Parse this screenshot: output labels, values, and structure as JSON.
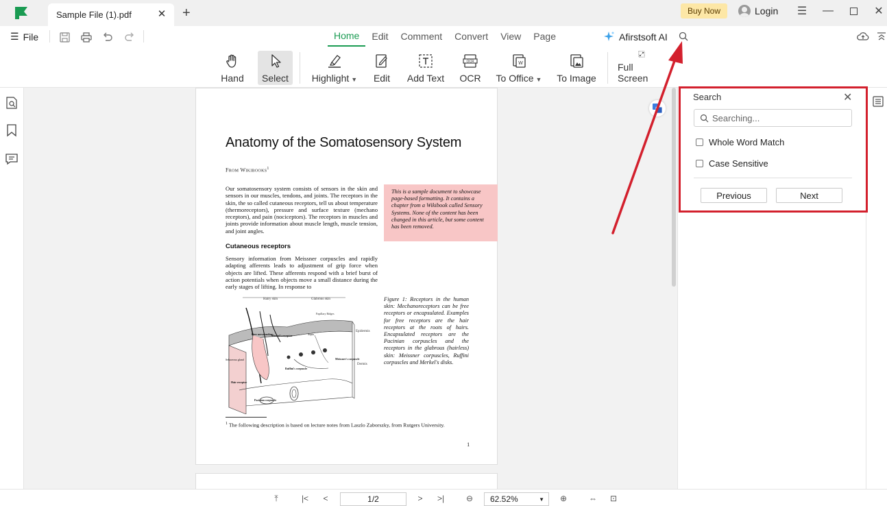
{
  "titlebar": {
    "tab_title": "Sample File (1).pdf",
    "buy_now": "Buy Now",
    "login": "Login"
  },
  "menubar": {
    "file": "File",
    "tabs": [
      "Home",
      "Edit",
      "Comment",
      "Convert",
      "View",
      "Page"
    ],
    "active_tab": "Home",
    "ai_label": "Afirstsoft AI"
  },
  "toolbar": {
    "hand": "Hand",
    "select": "Select",
    "highlight": "Highlight",
    "edit": "Edit",
    "add_text": "Add Text",
    "ocr": "OCR",
    "to_office": "To Office",
    "to_image": "To Image",
    "full_screen": "Full Screen"
  },
  "document": {
    "title": "Anatomy of the Somatosensory System",
    "byline": "From Wikibooks",
    "byline_sup": "1",
    "paragraph1": "Our somatosensory system consists of sensors in the skin and sensors in our muscles, tendons, and joints. The receptors in the skin, the so called cutaneous receptors, tell us about temperature (thermoreceptors), pressure and surface texture (mechano receptors), and pain (nociceptors). The receptors in muscles and joints provide information about muscle length, muscle tension, and joint angles.",
    "note": "This is a sample document to showcase page-based formatting. It contains a chapter from a Wikibook called Sensory Systems. None of the content has been changed in this article, but some content has been removed.",
    "subheading": "Cutaneous receptors",
    "paragraph2": "Sensory information from Meissner corpuscles and rapidly adapting afferents leads to adjustment of grip force when objects are lifted. These afferents respond with a brief burst of action potentials when objects move a small distance during the early stages of lifting. In response to",
    "caption": "Figure 1: Receptors in the human skin: Mechanoreceptors can be free receptors or encapsulated. Examples for free receptors are the hair receptors at the roots of hairs. Encapsulated receptors are the Pacinian corpuscles and the receptors in the glabrous (hairless) skin: Meissner corpuscles, Ruffini corpuscles and Merkel's disks.",
    "figure_labels": {
      "hairy": "Hairy skin",
      "glabrous": "Glabrous skin",
      "papillary": "Papillary Ridges",
      "epidermis": "Epidermis",
      "dermis": "Dermis",
      "free_nerve": "Free nerve ending",
      "merkel": "Merkel's receptor",
      "septa": "Septa",
      "sebaceous": "Sebaceous gland",
      "ruffini": "Ruffini's corpuscle",
      "meissner": "Meissner's corpuscle",
      "hair_receptor": "Hair receptor",
      "pacinian": "Pacinian corpuscle"
    },
    "footnote_sup": "1",
    "footnote": "The following description is based on lecture notes from Laszlo Zaborszky, from Rutgers University.",
    "page_number": "1"
  },
  "search_panel": {
    "title": "Search",
    "placeholder": "Searching...",
    "whole_word": "Whole Word Match",
    "case_sensitive": "Case Sensitive",
    "previous": "Previous",
    "next": "Next"
  },
  "statusbar": {
    "page": "1/2",
    "zoom": "62.52%"
  },
  "colors": {
    "accent": "#1a9b52",
    "annotation_red": "#d3202d",
    "note_bg": "#f8c6c6",
    "buy_now_bg": "#fde7a6"
  }
}
